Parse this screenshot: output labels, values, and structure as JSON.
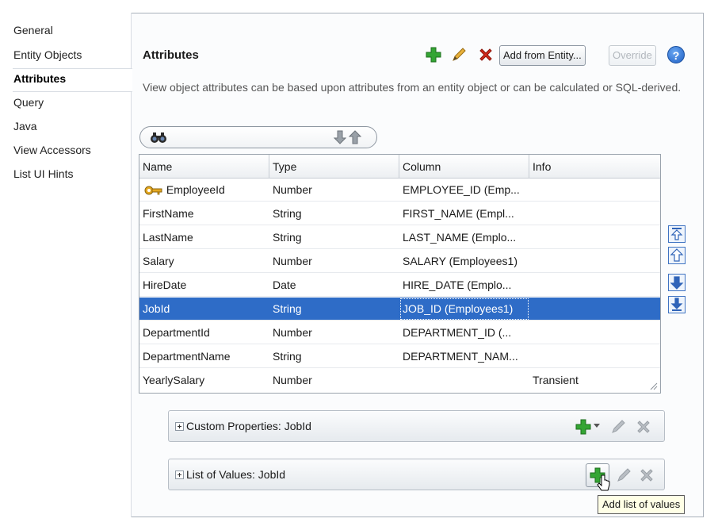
{
  "nav": {
    "items": [
      {
        "label": "General"
      },
      {
        "label": "Entity Objects"
      },
      {
        "label": "Attributes",
        "selected": true
      },
      {
        "label": "Query"
      },
      {
        "label": "Java"
      },
      {
        "label": "View Accessors"
      },
      {
        "label": "List UI Hints"
      }
    ]
  },
  "header": {
    "title": "Attributes",
    "description": "View object attributes can be based upon attributes from an entity object or can be calculated or SQL-derived.",
    "add_from_entity_label": "Add from Entity...",
    "override_label": "Override",
    "help_label": "?"
  },
  "table": {
    "columns": [
      "Name",
      "Type",
      "Column",
      "Info"
    ],
    "rows": [
      {
        "name": "EmployeeId",
        "type": "Number",
        "column": "EMPLOYEE_ID (Emp...",
        "info": "",
        "key": true
      },
      {
        "name": "FirstName",
        "type": "String",
        "column": "FIRST_NAME (Empl...",
        "info": ""
      },
      {
        "name": "LastName",
        "type": "String",
        "column": "LAST_NAME (Emplo...",
        "info": ""
      },
      {
        "name": "Salary",
        "type": "Number",
        "column": "SALARY (Employees1)",
        "info": ""
      },
      {
        "name": "HireDate",
        "type": "Date",
        "column": "HIRE_DATE (Emplo...",
        "info": ""
      },
      {
        "name": "JobId",
        "type": "String",
        "column": "JOB_ID (Employees1)",
        "info": "",
        "selected": true
      },
      {
        "name": "DepartmentId",
        "type": "Number",
        "column": "DEPARTMENT_ID (...",
        "info": ""
      },
      {
        "name": "DepartmentName",
        "type": "String",
        "column": "DEPARTMENT_NAM...",
        "info": ""
      },
      {
        "name": "YearlySalary",
        "type": "Number",
        "column": "",
        "info": "Transient"
      }
    ]
  },
  "panels": {
    "custom_properties": "Custom Properties: JobId",
    "list_of_values": "List of Values: JobId"
  },
  "tooltip": "Add list of values",
  "colors": {
    "selection": "#2e6cc7",
    "add_green": "#2f9e2f",
    "delete_red": "#d42a1c",
    "help_blue": "#1f5fc4"
  }
}
